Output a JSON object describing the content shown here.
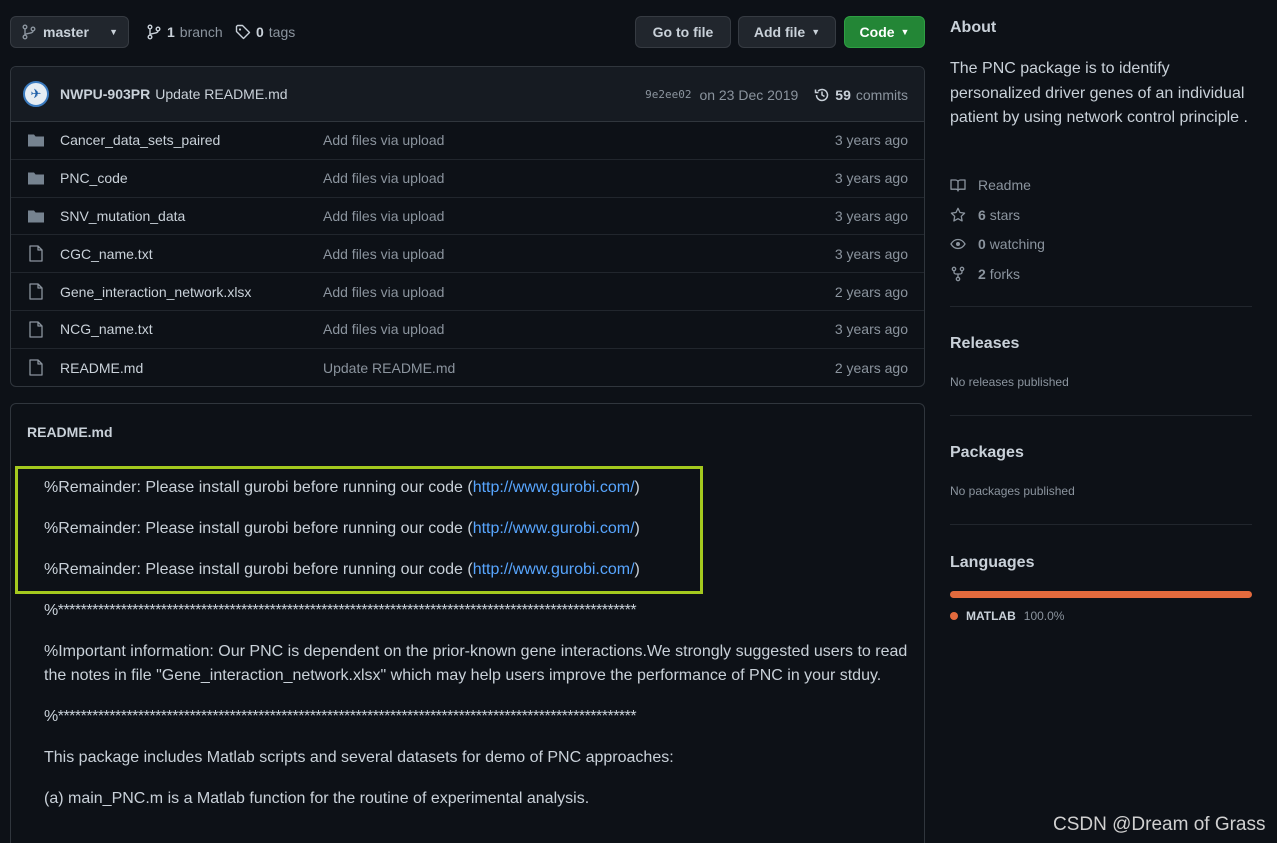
{
  "topbar": {
    "branch_label": "master",
    "branches_count": "1",
    "branches_label": "branch",
    "tags_count": "0",
    "tags_label": "tags",
    "go_to_file": "Go to file",
    "add_file": "Add file",
    "code": "Code"
  },
  "commit": {
    "author": "NWPU-903PR",
    "message": "Update README.md",
    "sha": "9e2ee02",
    "date": "on 23 Dec 2019",
    "commits_count": "59",
    "commits_label": "commits"
  },
  "files": [
    {
      "name": "Cancer_data_sets_paired",
      "message": "Add files via upload",
      "age": "3 years ago",
      "type": "folder"
    },
    {
      "name": "PNC_code",
      "message": "Add files via upload",
      "age": "3 years ago",
      "type": "folder"
    },
    {
      "name": "SNV_mutation_data",
      "message": "Add files via upload",
      "age": "3 years ago",
      "type": "folder"
    },
    {
      "name": "CGC_name.txt",
      "message": "Add files via upload",
      "age": "3 years ago",
      "type": "file"
    },
    {
      "name": "Gene_interaction_network.xlsx",
      "message": "Add files via upload",
      "age": "2 years ago",
      "type": "file"
    },
    {
      "name": "NCG_name.txt",
      "message": "Add files via upload",
      "age": "3 years ago",
      "type": "file"
    },
    {
      "name": "README.md",
      "message": "Update README.md",
      "age": "2 years ago",
      "type": "file"
    }
  ],
  "readme": {
    "title": "README.md",
    "reminder_text": "%Remainder: Please install gurobi before running our code (",
    "reminder_link": "http://www.gurobi.com/",
    "reminder_close": ")",
    "separator": "%*****************************************************************************************************",
    "important": "%Important information: Our PNC is dependent on the prior-known gene interactions.We strongly suggested users to read the notes in file \"Gene_interaction_network.xlsx\" which may help users improve the performance of PNC in your stduy.",
    "package_line": "This package includes Matlab scripts and several datasets for demo of PNC approaches:",
    "main_line": "(a) main_PNC.m is a Matlab function for the routine of experimental analysis."
  },
  "about": {
    "title": "About",
    "description": "The PNC package is to identify personalized driver genes of an individual patient by using network control principle .",
    "readme": "Readme",
    "stars_count": "6",
    "stars_label": "stars",
    "watching_count": "0",
    "watching_label": "watching",
    "forks_count": "2",
    "forks_label": "forks"
  },
  "releases": {
    "title": "Releases",
    "sub": "No releases published"
  },
  "packages": {
    "title": "Packages",
    "sub": "No packages published"
  },
  "languages": {
    "title": "Languages",
    "name": "MATLAB",
    "percent": "100.0%",
    "share": 1.0,
    "color": "#e36a3d"
  },
  "watermark": "CSDN @Dream of Grass"
}
